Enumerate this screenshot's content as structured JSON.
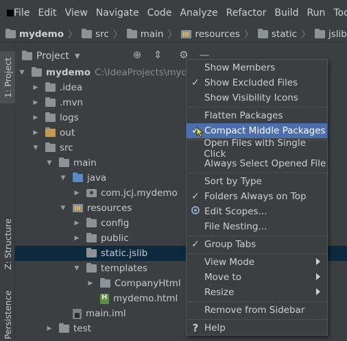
{
  "menubar": {
    "items": [
      {
        "label": "File"
      },
      {
        "label": "Edit"
      },
      {
        "label": "View"
      },
      {
        "label": "Navigate"
      },
      {
        "label": "Code"
      },
      {
        "label": "Analyze"
      },
      {
        "label": "Refactor"
      },
      {
        "label": "Build"
      },
      {
        "label": "Run"
      },
      {
        "label": "Tools"
      }
    ]
  },
  "breadcrumb": [
    "mydemo",
    "src",
    "main",
    "resources",
    "static",
    "jslib"
  ],
  "sidebar": {
    "project_tab": "1: Project",
    "structure_tab": "Z: Structure",
    "persistence_tab": "Persistence"
  },
  "panel": {
    "title": "Project",
    "icons": [
      "target-icon",
      "collapse-icon",
      "gear-icon",
      "minimize-icon"
    ]
  },
  "tree": {
    "root_label": "mydemo",
    "root_path": "C:\\IdeaProjects\\mydemo",
    "items": [
      {
        "label": "mydemo"
      },
      {
        "label": ".idea"
      },
      {
        "label": ".mvn"
      },
      {
        "label": "logs"
      },
      {
        "label": "out"
      },
      {
        "label": "src"
      },
      {
        "label": "main"
      },
      {
        "label": "java"
      },
      {
        "label": "com.jcj.mydemo"
      },
      {
        "label": "resources"
      },
      {
        "label": "config"
      },
      {
        "label": "public"
      },
      {
        "label": "static.jslib"
      },
      {
        "label": "templates"
      },
      {
        "label": "CompanyHtml"
      },
      {
        "label": "mydemo.html"
      },
      {
        "label": "main.iml"
      },
      {
        "label": "test"
      }
    ]
  },
  "context_menu": {
    "items": [
      {
        "label": "Show Members",
        "checked": false
      },
      {
        "label": "Show Excluded Files",
        "checked": true
      },
      {
        "label": "Show Visibility Icons",
        "checked": false
      },
      {
        "label": "Flatten Packages",
        "checked": false
      },
      {
        "label": "Compact Middle Packages",
        "checked": true
      },
      {
        "label": "Open Files with Single Click",
        "checked": false
      },
      {
        "label": "Always Select Opened File",
        "checked": false
      },
      {
        "label": "Sort by Type",
        "checked": false
      },
      {
        "label": "Folders Always on Top",
        "checked": true
      },
      {
        "label": "Edit Scopes...",
        "checked": false
      },
      {
        "label": "File Nesting...",
        "checked": false
      },
      {
        "label": "Group Tabs",
        "checked": true
      },
      {
        "label": "View Mode",
        "checked": false
      },
      {
        "label": "Move to",
        "checked": false
      },
      {
        "label": "Resize",
        "checked": false
      },
      {
        "label": "Remove from Sidebar",
        "checked": false
      },
      {
        "label": "Help",
        "checked": false
      }
    ]
  },
  "colors": {
    "background": "#3c3f41",
    "selection": "#0d293e",
    "menu_hover": "#4b6eaf"
  }
}
